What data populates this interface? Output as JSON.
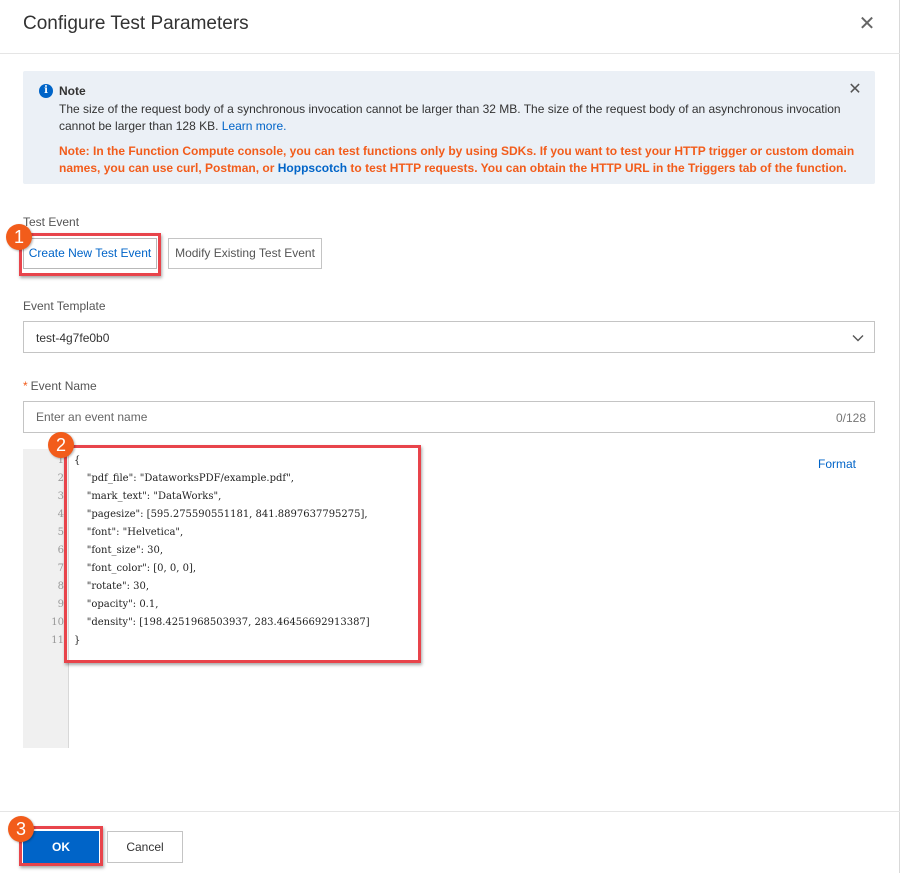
{
  "dialog": {
    "title": "Configure Test Parameters",
    "close_icon": "close-icon"
  },
  "note": {
    "title": "Note",
    "text": "The size of the request body of a synchronous invocation cannot be larger than 32 MB. The size of the request body of an asynchronous invocation cannot be larger than 128 KB. ",
    "learn_more": "Learn more.",
    "warning_part1": "Note: In the Function Compute console, you can test functions only by using SDKs. If you want to test your HTTP trigger or custom domain names, you can use curl, Postman, or ",
    "warning_link": "Hoppscotch",
    "warning_part2": " to test HTTP requests. You can obtain the HTTP URL in the Triggers tab of the function.",
    "info_icon": "info-icon",
    "close_icon": "close-icon"
  },
  "test_event": {
    "label": "Test Event",
    "create_label": "Create New Test Event",
    "modify_label": "Modify Existing Test Event"
  },
  "event_template": {
    "label": "Event Template",
    "value": "test-4g7fe0b0",
    "icon": "chevron-down-icon"
  },
  "event_name": {
    "required_mark": "*",
    "label": "Event Name",
    "placeholder": "Enter an event name",
    "value": "",
    "counter": "0/128"
  },
  "editor": {
    "format_label": "Format",
    "lines": [
      "{",
      "    \"pdf_file\": \"DataworksPDF/example.pdf\",",
      "    \"mark_text\": \"DataWorks\",",
      "    \"pagesize\": [595.275590551181, 841.8897637795275],",
      "    \"font\": \"Helvetica\",",
      "    \"font_size\": 30,",
      "    \"font_color\": [0, 0, 0],",
      "    \"rotate\": 30,",
      "    \"opacity\": 0.1,",
      "    \"density\": [198.4251968503937, 283.46456692913387]",
      "}"
    ],
    "line_numbers": [
      "1",
      "2",
      "3",
      "4",
      "5",
      "6",
      "7",
      "8",
      "9",
      "10",
      "11"
    ]
  },
  "footer": {
    "ok_label": "OK",
    "cancel_label": "Cancel"
  },
  "annotations": {
    "marker_1": "1",
    "marker_2": "2",
    "marker_3": "3",
    "highlight_color": "#e8444b",
    "marker_color": "#f25c1b"
  },
  "colors": {
    "primary": "#0064c8",
    "warning": "#f25c1b",
    "note_bg": "#ebf0f6"
  }
}
